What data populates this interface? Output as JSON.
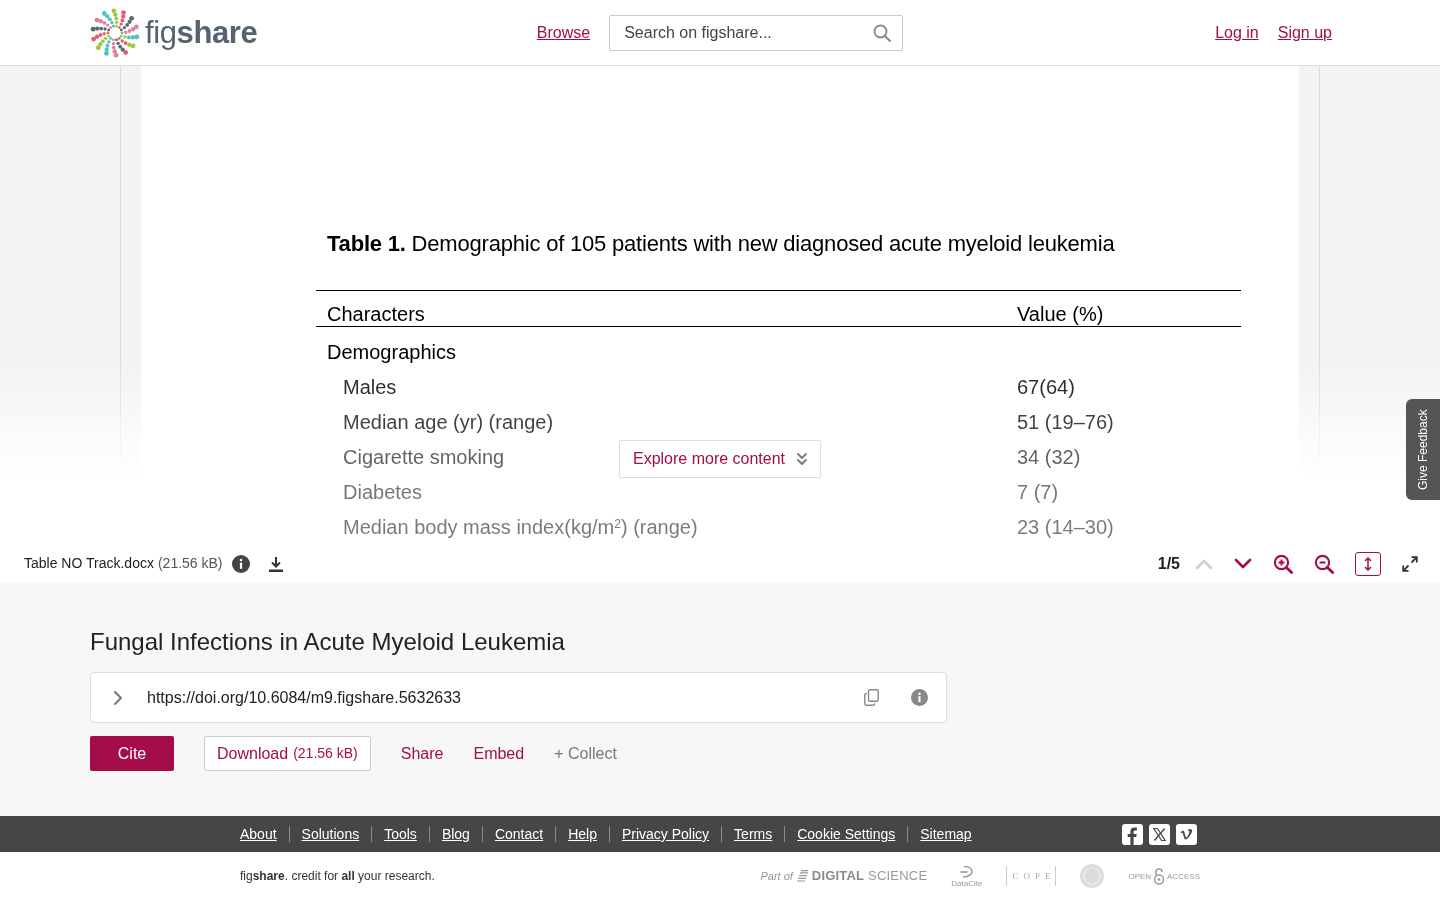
{
  "header": {
    "logo": "fig**share**",
    "nav_links": [
      "Browse"
    ],
    "search": {
      "placeholder": "Search on figshare..."
    },
    "account_links": [
      "Log in",
      "Sign up"
    ]
  },
  "preview": {
    "document": {
      "caption": "**Table 1.** Demographic of 105 patients with new diagnosed acute myeloid leukemia",
      "columns": [
        "Characters",
        "Value (%)"
      ],
      "sections": [
        {
          "title": "Demographics",
          "rows": [
            {
              "label": "Males",
              "value": "67(64)"
            },
            {
              "label": "Median age (yr) (range)",
              "value": "51 (19–76)"
            },
            {
              "label": "Cigarette smoking",
              "value": "34 (32)"
            },
            {
              "label": "Diabetes",
              "value": "7 (7)"
            },
            {
              "label": "Median body mass index(kg/m$^{2}$) (range)",
              "value": "23 (14–30)"
            }
          ]
        }
      ]
    },
    "explore_button": "Explore more content"
  },
  "feedback_tab": "Give Feedback",
  "viewer_toolbar": {
    "file_name": "Table NO Track.docx",
    "file_size": "(21.56 kB)",
    "page": "1/5",
    "page_nav": [
      {
        "kind": "previous",
        "disabled": true
      },
      {
        "kind": "next",
        "disabled": false
      }
    ],
    "zoom": [
      {
        "kind": "in"
      },
      {
        "kind": "out"
      }
    ],
    "fit_height": {
      "on": true
    }
  },
  "item": {
    "title": "Fungal Infections in Acute Myeloid Leukemia",
    "doi": {
      "url": "https://doi.org/10.6084/m9.figshare.5632633",
      "expanded": false
    },
    "actions": [
      {
        "kind": "cite",
        "label": "Cite"
      },
      {
        "kind": "download",
        "label": "Download",
        "note": "(21.56 kB)"
      },
      {
        "kind": "share",
        "label": "Share"
      },
      {
        "kind": "embed",
        "label": "Embed"
      },
      {
        "kind": "collect",
        "label": "+ Collect"
      }
    ]
  },
  "footer": {
    "links": [
      "About",
      "Solutions",
      "Tools",
      "Blog",
      "Contact",
      "Help",
      "Privacy Policy",
      "Terms",
      "Cookie Settings",
      "Sitemap"
    ],
    "tagline": "fig**share**. credit for **all** your research.",
    "partners": [
      {
        "kind": "digital-science",
        "prefix": "Part of",
        "name": "**DIGITAL** SCIENCE"
      },
      {
        "kind": "datacite",
        "name": "DataCite"
      },
      {
        "kind": "cope",
        "name": "COPE"
      },
      {
        "kind": "seal"
      },
      {
        "kind": "open-access",
        "prefix": "OPEN",
        "suffix": "ACCESS"
      }
    ]
  }
}
